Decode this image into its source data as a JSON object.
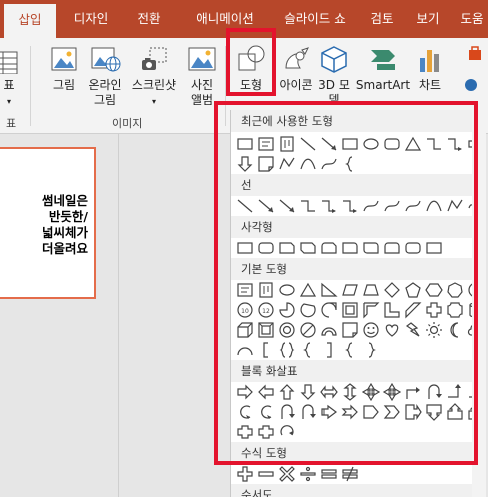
{
  "tabs": [
    "삽입",
    "디자인",
    "전환",
    "애니메이션",
    "슬라이드 쇼",
    "검토",
    "보기",
    "도움"
  ],
  "ribbon": {
    "partial_left_top": "표",
    "partial_left_group": "표",
    "group_images": "이미지",
    "buttons": {
      "picture": "그림",
      "online_picture_1": "온라인",
      "online_picture_2": "그림",
      "screenshot": "스크린샷",
      "album_1": "사진",
      "album_2": "앨범",
      "shape": "도형",
      "icon": "아이콘",
      "model_1": "3D 모",
      "model_2": "델",
      "smartart": "SmartArt",
      "chart": "차트"
    }
  },
  "slide": {
    "text": "썸네일은\n반듯한/\n넓씨체가\n더올려요"
  },
  "gallery": {
    "sections": [
      "최근에 사용한 도형",
      "선",
      "사각형",
      "기본 도형",
      "블록 화살표",
      "수식 도형",
      "순서도"
    ]
  },
  "colors": {
    "accent": "#b7472a",
    "highlight": "#e3132d",
    "slide_border": "#e46c4a"
  }
}
